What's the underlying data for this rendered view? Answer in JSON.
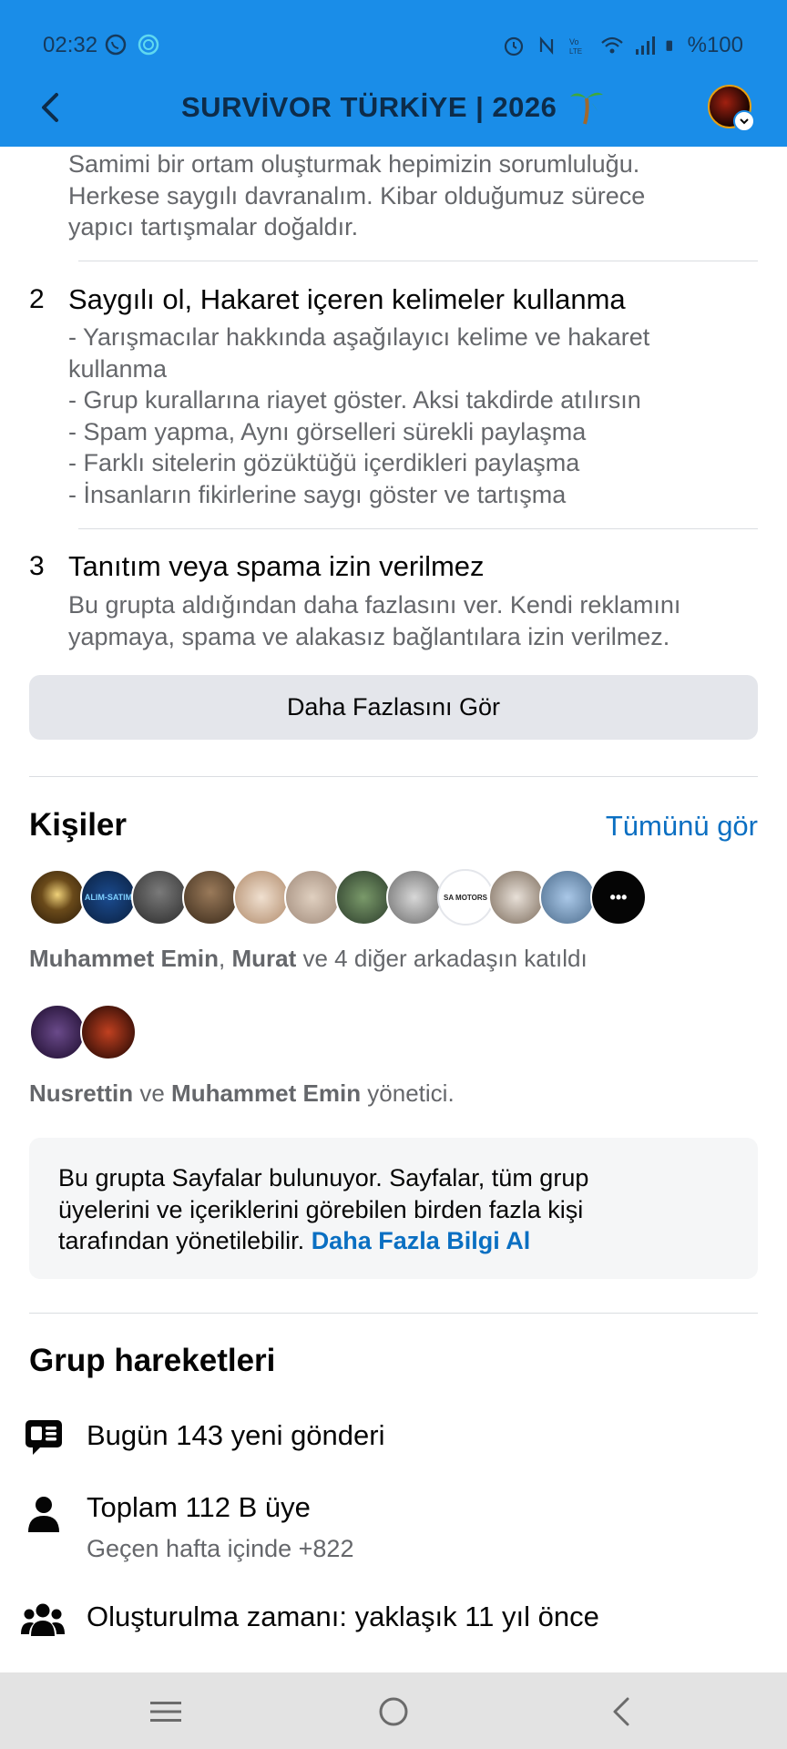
{
  "status_bar": {
    "time": "02:32",
    "battery": "%100"
  },
  "app_bar": {
    "title": "SURVİVOR TÜRKİYE | 2026",
    "accent_color": "#1a8de8"
  },
  "rules": {
    "intro_lines": [
      "Samimi bir ortam oluşturmak hepimizin sorumluluğu.",
      "Herkese saygılı davranalım. Kibar olduğumuz sürece",
      "yapıcı tartışmalar doğaldır."
    ],
    "items": [
      {
        "number": "2",
        "title": "Saygılı ol, Hakaret içeren kelimeler kullanma",
        "lines": [
          "- Yarışmacılar hakkında aşağılayıcı kelime ve hakaret",
          "kullanma",
          "- Grup kurallarına riayet göster. Aksi takdirde atılırsın",
          "- Spam yapma, Aynı görselleri sürekli paylaşma",
          "- Farklı sitelerin gözüktüğü içerdikleri paylaşma",
          "- İnsanların fikirlerine saygı göster ve tartışma"
        ]
      },
      {
        "number": "3",
        "title": "Tanıtım veya spama izin verilmez",
        "lines": [
          "Bu grupta aldığından daha fazlasını ver. Kendi reklamını",
          "yapmaya, spama ve alakasız bağlantılara izin verilmez."
        ]
      }
    ],
    "see_more_label": "Daha Fazlasını Gör"
  },
  "people": {
    "title": "Kişiler",
    "see_all_label": "Tümünü gör",
    "member_avatars": [
      {
        "colors": [
          "#f0d27a",
          "#3a2a12"
        ]
      },
      {
        "colors": [
          "#1b4b8f",
          "#0a1f3d"
        ],
        "label": "ALIM-SATIM"
      },
      {
        "colors": [
          "#6b6b6b",
          "#2b2b2b"
        ]
      },
      {
        "colors": [
          "#8a6a4a",
          "#3a2a1a"
        ]
      },
      {
        "colors": [
          "#e8d8c8",
          "#b08a6a"
        ]
      },
      {
        "colors": [
          "#d8c8b8",
          "#a08a7a"
        ]
      },
      {
        "colors": [
          "#6a8a5a",
          "#2a3a2a"
        ]
      },
      {
        "colors": [
          "#c8c8c8",
          "#6a6a6a"
        ]
      },
      {
        "colors": [
          "#ffffff",
          "#d0d0d0"
        ],
        "label": "SA MOTORS"
      },
      {
        "colors": [
          "#d8d0c8",
          "#7a6a5a"
        ]
      },
      {
        "colors": [
          "#9ab8d8",
          "#4a6a8a"
        ]
      }
    ],
    "more_label": "•••",
    "friends_name_1": "Muhammet Emin",
    "friends_name_2": "Murat",
    "friends_suffix": " ve 4 diğer arkadaşın katıldı",
    "admin_name_1": "Nusrettin",
    "admin_mid": " ve ",
    "admin_name_2": "Muhammet Emin",
    "admin_suffix": " yönetici."
  },
  "pages_info": {
    "line_1": "Bu grupta Sayfalar bulunuyor. Sayfalar, tüm grup",
    "line_2": "üyelerini ve içeriklerini görebilen birden fazla kişi",
    "line_3": "tarafından yönetilebilir. ",
    "link_label": "Daha Fazla Bilgi Al"
  },
  "group_activity": {
    "title": "Grup hareketleri",
    "posts_today": "Bugün 143 yeni gönderi",
    "total_members": "Toplam 112 B üye",
    "members_growth": "Geçen hafta içinde +822",
    "created": "Oluşturulma zamanı: yaklaşık 11 yıl önce",
    "icons": [
      "posts-icon",
      "person-icon",
      "group-icon"
    ]
  },
  "nav_bar": {
    "icons": [
      "menu-icon",
      "home-icon",
      "back-icon"
    ]
  }
}
